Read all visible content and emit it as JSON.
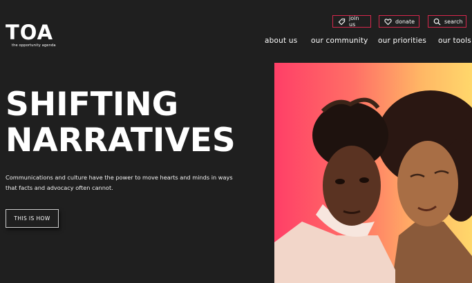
{
  "brand": {
    "logo_text": "TOA",
    "tagline": "the opportunity agenda"
  },
  "utility_nav": [
    {
      "label": "join us",
      "icon": "tag-icon"
    },
    {
      "label": "donate",
      "icon": "heart-icon"
    },
    {
      "label": "search",
      "icon": "search-icon"
    }
  ],
  "main_nav": [
    {
      "label": "about us"
    },
    {
      "label": "our community"
    },
    {
      "label": "our priorities"
    },
    {
      "label": "our tools"
    }
  ],
  "hero": {
    "title_line1": "SHIFTING",
    "title_line2": "NARRATIVES",
    "description": "Communications and culture have the power to move hearts and minds in ways that facts and advocacy often cannot.",
    "cta_label": "THIS IS HOW"
  },
  "colors": {
    "background": "#1f1f1f",
    "accent": "#d6284d",
    "gradient_start": "#ff3f67",
    "gradient_end": "#ffd76b"
  }
}
